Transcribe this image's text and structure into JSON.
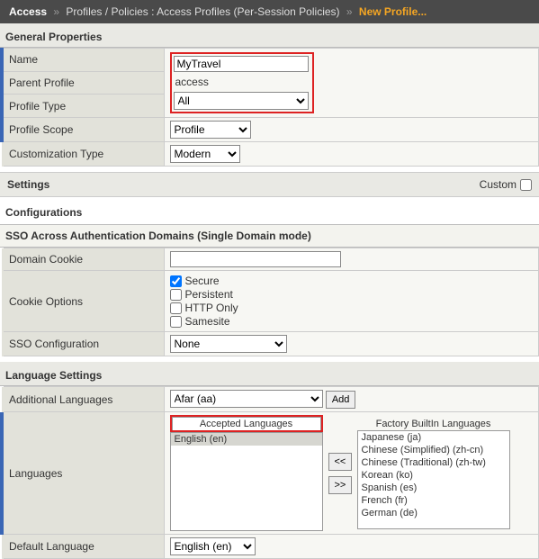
{
  "breadcrumb": {
    "root": "Access",
    "mid": "Profiles / Policies : Access Profiles (Per-Session Policies)",
    "current": "New Profile..."
  },
  "sections": {
    "general": "General Properties",
    "settings": "Settings",
    "configurations": "Configurations",
    "sso": "SSO Across Authentication Domains (Single Domain mode)",
    "language": "Language Settings"
  },
  "general": {
    "name_label": "Name",
    "name_value": "MyTravel",
    "parent_label": "Parent Profile",
    "parent_value": "access",
    "type_label": "Profile Type",
    "type_value": "All",
    "scope_label": "Profile Scope",
    "scope_value": "Profile",
    "custtype_label": "Customization Type",
    "custtype_value": "Modern"
  },
  "settings": {
    "custom_label": "Custom"
  },
  "sso": {
    "domain_label": "Domain Cookie",
    "domain_value": "",
    "cookie_label": "Cookie Options",
    "opts": {
      "secure": "Secure",
      "persistent": "Persistent",
      "httponly": "HTTP Only",
      "samesite": "Samesite"
    },
    "secure_checked": true,
    "config_label": "SSO Configuration",
    "config_value": "None"
  },
  "language": {
    "additional_label": "Additional Languages",
    "additional_value": "Afar (aa)",
    "add_btn": "Add",
    "languages_label": "Languages",
    "accepted_title": "Accepted Languages",
    "accepted_items": [
      "English (en)"
    ],
    "factory_title": "Factory BuiltIn Languages",
    "factory_items": [
      "Japanese (ja)",
      "Chinese (Simplified) (zh-cn)",
      "Chinese (Traditional) (zh-tw)",
      "Korean (ko)",
      "Spanish (es)",
      "French (fr)",
      "German (de)"
    ],
    "move_left": "<<",
    "move_right": ">>",
    "default_label": "Default Language",
    "default_value": "English (en)"
  }
}
